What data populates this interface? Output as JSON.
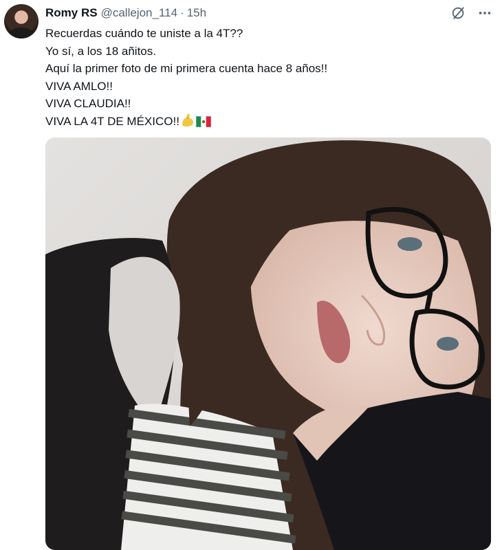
{
  "author": {
    "name": "Romy RS",
    "handle": "@callejon_114",
    "separator": "·",
    "time": "15h"
  },
  "icons": {
    "avatar": "avatar-photo",
    "grok": "grok-icon",
    "more": "more-icon"
  },
  "tweet": {
    "lines": [
      "Recuerdas cuándo te uniste a la 4T??",
      "Yo sí, a los 18 añitos.",
      "Aquí la primer foto de mi primera cuenta hace 8 años!!",
      "VIVA AMLO!!",
      "VIVA CLAUDIA!!",
      "VIVA LA 4T DE MÉXICO!!"
    ],
    "emojis": [
      "flexed-biceps-emoji",
      "mexico-flag-emoji"
    ]
  },
  "media": {
    "type": "photo",
    "description_icon": "selfie-photo"
  },
  "colors": {
    "text": "#0f1419",
    "secondary": "#536471",
    "background": "#ffffff"
  }
}
